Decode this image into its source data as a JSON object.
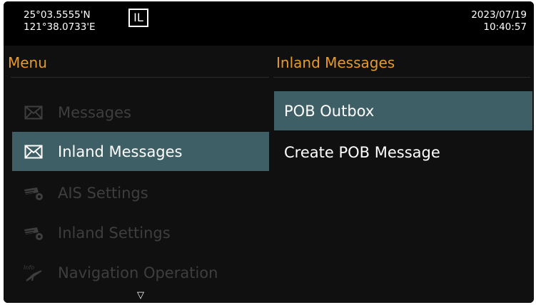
{
  "status": {
    "lat": "25°03.5555'N",
    "lon": "121°38.0733'E",
    "mode": "IL",
    "date": "2023/07/19",
    "time": "10:40:57"
  },
  "menu": {
    "title": "Menu",
    "items": [
      {
        "label": "Messages",
        "icon": "envelope-icon"
      },
      {
        "label": "Inland Messages",
        "icon": "envelope-icon"
      },
      {
        "label": "AIS Settings",
        "icon": "settings-gear-icon"
      },
      {
        "label": "Inland Settings",
        "icon": "settings-gear-icon"
      },
      {
        "label": "Navigation Operation",
        "icon": "info-navigation-icon"
      }
    ],
    "more_indicator": "▽"
  },
  "submenu": {
    "title": "Inland Messages",
    "items": [
      {
        "label": "POB Outbox"
      },
      {
        "label": "Create POB Message"
      }
    ]
  },
  "colors": {
    "accent": "#e69a2c",
    "selection": "#3e5f66",
    "disabled_text": "#3e3e3e"
  }
}
